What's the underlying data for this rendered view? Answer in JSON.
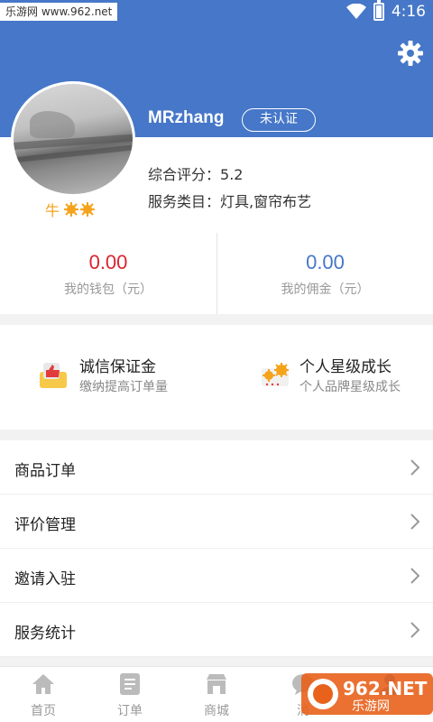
{
  "status_bar": {
    "watermark": "乐游网 www.962.net",
    "time": "4:16"
  },
  "profile": {
    "username": "MRzhang",
    "verify_status": "未认证",
    "level_label": "牛",
    "rating_label": "综合评分：",
    "rating_value": "5.2",
    "service_label": "服务类目：",
    "service_value": "灯具,窗帘布艺"
  },
  "wallet": {
    "balance_value": "0.00",
    "balance_label": "我的钱包（元）",
    "commission_value": "0.00",
    "commission_label": "我的佣金（元）"
  },
  "promos": [
    {
      "title": "诚信保证金",
      "subtitle": "缴纳提高订单量",
      "icon": "thumbs-up-icon"
    },
    {
      "title": "个人星级成长",
      "subtitle": "个人品牌星级成长",
      "icon": "stars-icon"
    }
  ],
  "menu": [
    {
      "label": "商品订单"
    },
    {
      "label": "评价管理"
    },
    {
      "label": "邀请入驻"
    },
    {
      "label": "服务统计"
    }
  ],
  "tabs": [
    {
      "label": "首页",
      "icon": "home-icon"
    },
    {
      "label": "订单",
      "icon": "order-icon"
    },
    {
      "label": "商城",
      "icon": "store-icon"
    },
    {
      "label": "消",
      "icon": "message-icon"
    },
    {
      "label": "",
      "icon": "profile-icon"
    }
  ],
  "colors": {
    "header_blue": "#4677c8",
    "balance_red": "#d9252f",
    "commission_blue": "#4677c8",
    "level_orange": "#f5a31a"
  },
  "watermark_br": "962.NET 乐游网"
}
